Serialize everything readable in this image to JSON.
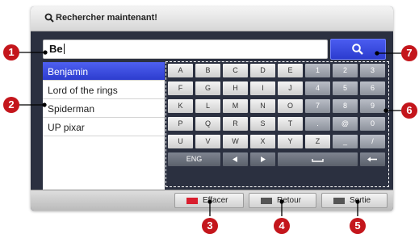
{
  "window": {
    "title": "Rechercher maintenant!"
  },
  "search": {
    "value": "Be",
    "button_icon": "search-icon"
  },
  "suggestions": [
    {
      "label": "Benjamin",
      "selected": true
    },
    {
      "label": "Lord of the rings",
      "selected": false
    },
    {
      "label": "Spiderman",
      "selected": false
    },
    {
      "label": "UP pixar",
      "selected": false
    }
  ],
  "keyboard": {
    "letter_rows": [
      [
        "A",
        "B",
        "C",
        "D",
        "E"
      ],
      [
        "F",
        "G",
        "H",
        "I",
        "J"
      ],
      [
        "K",
        "L",
        "M",
        "N",
        "O"
      ],
      [
        "P",
        "Q",
        "R",
        "S",
        "T"
      ],
      [
        "U",
        "V",
        "W",
        "X",
        "Y",
        "Z"
      ]
    ],
    "number_rows": [
      [
        "1",
        "2",
        "3"
      ],
      [
        "4",
        "5",
        "6"
      ],
      [
        "7",
        "8",
        "9"
      ],
      [
        ".",
        "@",
        "0"
      ],
      [
        "_",
        "/"
      ]
    ],
    "bottom_row": {
      "lang": "ENG",
      "left_icon": "arrow-left-icon",
      "right_icon": "arrow-right-icon",
      "space_icon": "space-icon",
      "backspace_icon": "backspace-icon"
    }
  },
  "bottom_buttons": [
    {
      "label": "Effacer",
      "icon": "red-button-icon",
      "icon_color": "#d91e2e"
    },
    {
      "label": "Retour",
      "icon": "return-icon",
      "icon_color": "#555555"
    },
    {
      "label": "Sortie",
      "icon": "exit-icon",
      "icon_color": "#555555"
    }
  ],
  "callouts": [
    "1",
    "2",
    "3",
    "4",
    "5",
    "6",
    "7"
  ],
  "colors": {
    "accent": "#3347e0",
    "panel": "#2b3040",
    "callout": "#c4161c"
  }
}
